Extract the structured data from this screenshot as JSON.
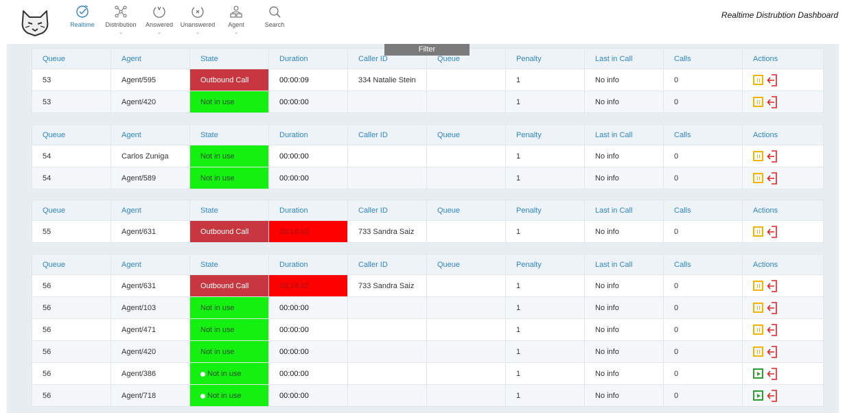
{
  "app": {
    "title": "Realtime Distrubtion Dashboard"
  },
  "nav": [
    {
      "label": "Realtime",
      "icon": "check-clock-icon",
      "active": true,
      "chevron": ""
    },
    {
      "label": "Distribution",
      "icon": "network-nodes-icon",
      "active": false,
      "chevron": "⌄"
    },
    {
      "label": "Answered",
      "icon": "call-answered-icon",
      "active": false,
      "chevron": "⌄"
    },
    {
      "label": "Unanswered",
      "icon": "call-unanswered-icon",
      "active": false,
      "chevron": "⌄"
    },
    {
      "label": "Agent",
      "icon": "agent-users-icon",
      "active": false,
      "chevron": "⌄"
    },
    {
      "label": "Search",
      "icon": "magnifier-icon",
      "active": false,
      "chevron": ""
    }
  ],
  "filter": {
    "label": "Filter"
  },
  "columns": [
    "Queue",
    "Agent",
    "State",
    "Duration",
    "Caller ID",
    "Queue",
    "Penalty",
    "Last in Call",
    "Calls",
    "Actions"
  ],
  "groups": [
    {
      "rows": [
        {
          "queue": "53",
          "agent": "Agent/595",
          "state": "Outbound Call",
          "state_kind": "outbound",
          "duration": "00:00:09",
          "duration_alert": false,
          "caller_id": "334 Natalie Stein",
          "queue2": "",
          "penalty": "1",
          "last_call": "No info",
          "calls": "0",
          "action": "pause"
        },
        {
          "queue": "53",
          "agent": "Agent/420",
          "state": "Not in use",
          "state_kind": "idle",
          "duration": "00:00:00",
          "duration_alert": false,
          "caller_id": "",
          "queue2": "",
          "penalty": "1",
          "last_call": "No info",
          "calls": "0",
          "action": "pause"
        }
      ]
    },
    {
      "rows": [
        {
          "queue": "54",
          "agent": "Carlos Zuniga",
          "state": "Not in use",
          "state_kind": "idle",
          "duration": "00:00:00",
          "duration_alert": false,
          "caller_id": "",
          "queue2": "",
          "penalty": "1",
          "last_call": "No info",
          "calls": "0",
          "action": "pause"
        },
        {
          "queue": "54",
          "agent": "Agent/589",
          "state": "Not in use",
          "state_kind": "idle",
          "duration": "00:00:00",
          "duration_alert": false,
          "caller_id": "",
          "queue2": "",
          "penalty": "1",
          "last_call": "No info",
          "calls": "0",
          "action": "pause"
        }
      ]
    },
    {
      "rows": [
        {
          "queue": "55",
          "agent": "Agent/631",
          "state": "Outbound Call",
          "state_kind": "outbound",
          "duration": "00:14:42",
          "duration_alert": true,
          "caller_id": "733 Sandra Saiz",
          "queue2": "",
          "penalty": "1",
          "last_call": "No info",
          "calls": "0",
          "action": "pause"
        }
      ]
    },
    {
      "rows": [
        {
          "queue": "56",
          "agent": "Agent/631",
          "state": "Outbound Call",
          "state_kind": "outbound",
          "duration": "00:14:42",
          "duration_alert": true,
          "caller_id": "733 Sandra Saiz",
          "queue2": "",
          "penalty": "1",
          "last_call": "No info",
          "calls": "0",
          "action": "pause"
        },
        {
          "queue": "56",
          "agent": "Agent/103",
          "state": "Not in use",
          "state_kind": "idle",
          "duration": "00:00:00",
          "duration_alert": false,
          "caller_id": "",
          "queue2": "",
          "penalty": "1",
          "last_call": "No info",
          "calls": "0",
          "action": "pause"
        },
        {
          "queue": "56",
          "agent": "Agent/471",
          "state": "Not in use",
          "state_kind": "idle",
          "duration": "00:00:00",
          "duration_alert": false,
          "caller_id": "",
          "queue2": "",
          "penalty": "1",
          "last_call": "No info",
          "calls": "0",
          "action": "pause"
        },
        {
          "queue": "56",
          "agent": "Agent/420",
          "state": "Not in use",
          "state_kind": "idle",
          "duration": "00:00:00",
          "duration_alert": false,
          "caller_id": "",
          "queue2": "",
          "penalty": "1",
          "last_call": "No info",
          "calls": "0",
          "action": "pause"
        },
        {
          "queue": "56",
          "agent": "Agent/386",
          "state": "Not in use",
          "state_kind": "idle-paused",
          "duration": "00:00:00",
          "duration_alert": false,
          "caller_id": "",
          "queue2": "",
          "penalty": "1",
          "last_call": "No info",
          "calls": "0",
          "action": "play"
        },
        {
          "queue": "56",
          "agent": "Agent/718",
          "state": "Not in use",
          "state_kind": "idle-paused",
          "duration": "00:00:00",
          "duration_alert": false,
          "caller_id": "",
          "queue2": "",
          "penalty": "1",
          "last_call": "No info",
          "calls": "0",
          "action": "play"
        }
      ]
    }
  ],
  "colors": {
    "accent": "#2e7fc9",
    "outbound": "#c8373f",
    "idle": "#14f00f",
    "alert": "#ff0000",
    "pause": "#f4b400",
    "logout": "#e02020",
    "play": "#2ea02e"
  }
}
